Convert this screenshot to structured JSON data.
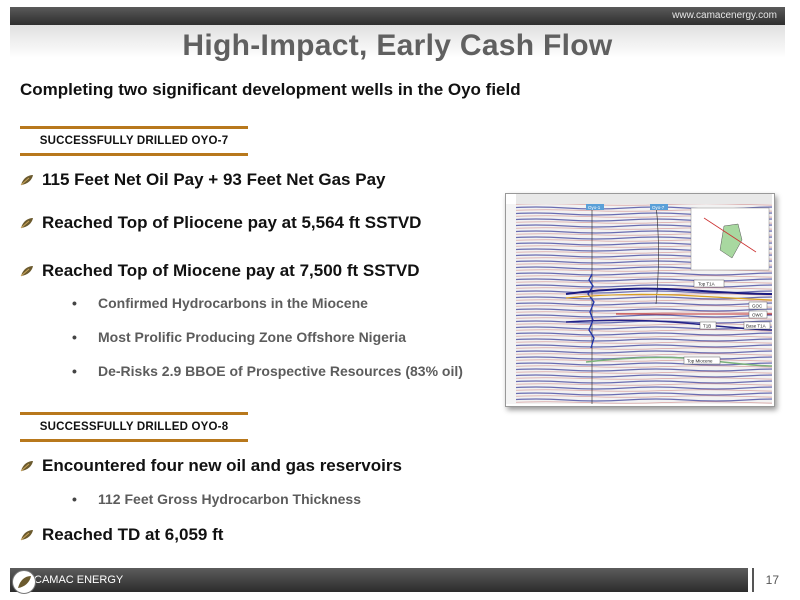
{
  "header": {
    "url": "www.camacenergy.com",
    "title": "High-Impact, Early Cash Flow"
  },
  "subtitle": "Completing two significant development wells in the Oyo field",
  "sections": [
    {
      "label": "SUCCESSFULLY DRILLED OYO-7",
      "bullets": [
        "115 Feet Net Oil Pay + 93 Feet Net Gas Pay",
        "Reached Top of Pliocene pay at 5,564 ft SSTVD",
        "Reached Top of Miocene pay at 7,500 ft SSTVD"
      ],
      "sub_bullets": [
        "Confirmed Hydrocarbons in the Miocene",
        "Most Prolific Producing Zone Offshore Nigeria",
        "De-Risks 2.9 BBOE of Prospective Resources (83% oil)"
      ]
    },
    {
      "label": "SUCCESSFULLY DRILLED OYO-8",
      "bullets": [
        "Encountered four new oil and gas reservoirs",
        "Reached TD at 6,059 ft"
      ],
      "sub_bullets": [
        "112 Feet Gross Hydrocarbon Thickness"
      ]
    }
  ],
  "seismic_image": {
    "well_labels": [
      "Oyo-1",
      "Oyo-7"
    ],
    "horizon_labels": [
      "Top T1A",
      "GOC",
      "OWC",
      "T1B",
      "Base T1A",
      "Top Miocene"
    ]
  },
  "footer": {
    "company": "CAMAC ENERGY",
    "page_number": "17"
  },
  "colors": {
    "accent": "#b8781c",
    "title": "#606060",
    "bar": "#3a3a3a"
  },
  "icons": {
    "bullet": "leaf-bullet-icon",
    "logo": "camac-logo-icon"
  }
}
